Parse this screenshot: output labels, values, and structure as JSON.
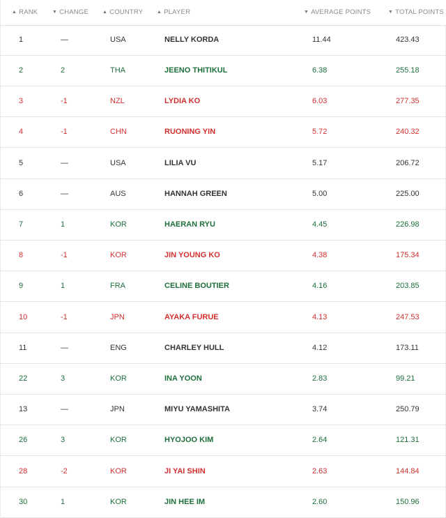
{
  "header": {
    "rank": "RANK",
    "change": "CHANGE",
    "country": "COUNTRY",
    "player": "PLAYER",
    "average_points": "AVERAGE POINTS",
    "total_points": "TOTAL POINTS"
  },
  "rows": [
    {
      "rank": "1",
      "change": "—",
      "country": "USA",
      "player": "NELLY KORDA",
      "avg": "11.44",
      "total": "423.43",
      "trend": "same"
    },
    {
      "rank": "2",
      "change": "2",
      "country": "THA",
      "player": "JEENO THITIKUL",
      "avg": "6.38",
      "total": "255.18",
      "trend": "up"
    },
    {
      "rank": "3",
      "change": "-1",
      "country": "NZL",
      "player": "LYDIA KO",
      "avg": "6.03",
      "total": "277.35",
      "trend": "down"
    },
    {
      "rank": "4",
      "change": "-1",
      "country": "CHN",
      "player": "RUONING YIN",
      "avg": "5.72",
      "total": "240.32",
      "trend": "down"
    },
    {
      "rank": "5",
      "change": "—",
      "country": "USA",
      "player": "LILIA VU",
      "avg": "5.17",
      "total": "206.72",
      "trend": "same"
    },
    {
      "rank": "6",
      "change": "—",
      "country": "AUS",
      "player": "HANNAH GREEN",
      "avg": "5.00",
      "total": "225.00",
      "trend": "same"
    },
    {
      "rank": "7",
      "change": "1",
      "country": "KOR",
      "player": "HAERAN RYU",
      "avg": "4.45",
      "total": "226.98",
      "trend": "up"
    },
    {
      "rank": "8",
      "change": "-1",
      "country": "KOR",
      "player": "JIN YOUNG KO",
      "avg": "4.38",
      "total": "175.34",
      "trend": "down"
    },
    {
      "rank": "9",
      "change": "1",
      "country": "FRA",
      "player": "CELINE BOUTIER",
      "avg": "4.16",
      "total": "203.85",
      "trend": "up"
    },
    {
      "rank": "10",
      "change": "-1",
      "country": "JPN",
      "player": "AYAKA FURUE",
      "avg": "4.13",
      "total": "247.53",
      "trend": "down"
    },
    {
      "rank": "11",
      "change": "—",
      "country": "ENG",
      "player": "CHARLEY HULL",
      "avg": "4.12",
      "total": "173.11",
      "trend": "same"
    },
    {
      "rank": "22",
      "change": "3",
      "country": "KOR",
      "player": "INA YOON",
      "avg": "2.83",
      "total": "99.21",
      "trend": "up"
    },
    {
      "rank": "13",
      "change": "—",
      "country": "JPN",
      "player": "MIYU YAMASHITA",
      "avg": "3.74",
      "total": "250.79",
      "trend": "same"
    },
    {
      "rank": "26",
      "change": "3",
      "country": "KOR",
      "player": "HYOJOO KIM",
      "avg": "2.64",
      "total": "121.31",
      "trend": "up"
    },
    {
      "rank": "28",
      "change": "-2",
      "country": "KOR",
      "player": "JI YAI SHIN",
      "avg": "2.63",
      "total": "144.84",
      "trend": "down"
    },
    {
      "rank": "30",
      "change": "1",
      "country": "KOR",
      "player": "JIN HEE IM",
      "avg": "2.60",
      "total": "150.96",
      "trend": "up"
    }
  ],
  "colors": {
    "up": "#1e6e3c",
    "down": "#d32f2f",
    "same": "#333333"
  },
  "icons": {
    "rank": "sort-up-arrow-icon",
    "change": "sort-down-arrow-icon",
    "country": "sort-up-arrow-icon",
    "player": "sort-up-arrow-icon",
    "average_points": "sort-down-arrow-icon",
    "total_points": "sort-down-arrow-icon"
  }
}
